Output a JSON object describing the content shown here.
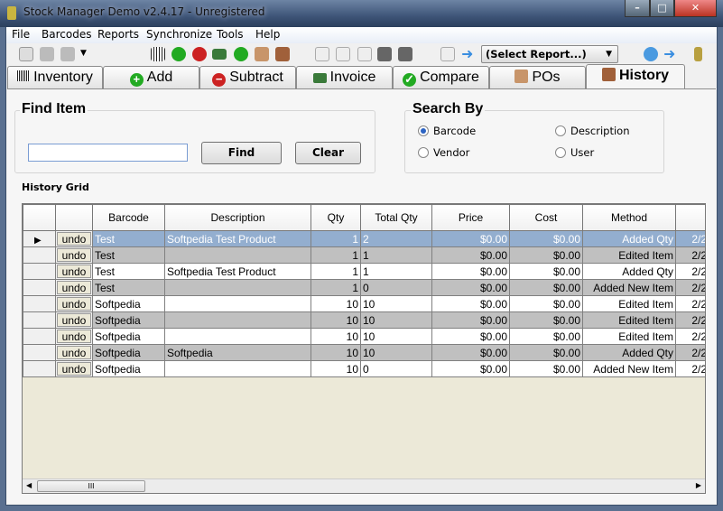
{
  "window": {
    "title": "Stock Manager Demo v2.4.17 - Unregistered",
    "minimize": "–",
    "maximize": "□",
    "close": "✕"
  },
  "menu": [
    "File",
    "Barcodes",
    "Reports",
    "Synchronize",
    "Tools",
    "Help"
  ],
  "toolbar": {
    "report_select": "(Select Report...)"
  },
  "tabs": [
    {
      "label": "Inventory"
    },
    {
      "label": "Add"
    },
    {
      "label": "Subtract"
    },
    {
      "label": "Invoice"
    },
    {
      "label": "Compare"
    },
    {
      "label": "POs"
    },
    {
      "label": "History"
    }
  ],
  "find": {
    "title": "Find Item",
    "value": "",
    "find_label": "Find",
    "clear_label": "Clear"
  },
  "search_by": {
    "title": "Search By",
    "options": [
      "Barcode",
      "Description",
      "Vendor",
      "User"
    ],
    "selected": "Barcode"
  },
  "grid": {
    "title": "History Grid",
    "columns": [
      "",
      "",
      "Barcode",
      "Description",
      "Qty",
      "Total Qty",
      "Price",
      "Cost",
      "Method",
      ""
    ],
    "undo_label": "undo",
    "rows": [
      {
        "barcode": "Test",
        "description": "Softpedia Test Product",
        "qty": "1",
        "total": "2",
        "price": "$0.00",
        "cost": "$0.00",
        "method": "Added Qty",
        "date": "2/2"
      },
      {
        "barcode": "Test",
        "description": "",
        "qty": "1",
        "total": "1",
        "price": "$0.00",
        "cost": "$0.00",
        "method": "Edited Item",
        "date": "2/2"
      },
      {
        "barcode": "Test",
        "description": "Softpedia Test Product",
        "qty": "1",
        "total": "1",
        "price": "$0.00",
        "cost": "$0.00",
        "method": "Added Qty",
        "date": "2/2"
      },
      {
        "barcode": "Test",
        "description": "",
        "qty": "1",
        "total": "0",
        "price": "$0.00",
        "cost": "$0.00",
        "method": "Added New Item",
        "date": "2/2"
      },
      {
        "barcode": "Softpedia",
        "description": "",
        "qty": "10",
        "total": "10",
        "price": "$0.00",
        "cost": "$0.00",
        "method": "Edited Item",
        "date": "2/2"
      },
      {
        "barcode": "Softpedia",
        "description": "",
        "qty": "10",
        "total": "10",
        "price": "$0.00",
        "cost": "$0.00",
        "method": "Edited Item",
        "date": "2/2"
      },
      {
        "barcode": "Softpedia",
        "description": "",
        "qty": "10",
        "total": "10",
        "price": "$0.00",
        "cost": "$0.00",
        "method": "Edited Item",
        "date": "2/2"
      },
      {
        "barcode": "Softpedia",
        "description": "Softpedia",
        "qty": "10",
        "total": "10",
        "price": "$0.00",
        "cost": "$0.00",
        "method": "Added Qty",
        "date": "2/2"
      },
      {
        "barcode": "Softpedia",
        "description": "",
        "qty": "10",
        "total": "0",
        "price": "$0.00",
        "cost": "$0.00",
        "method": "Added New Item",
        "date": "2/2"
      }
    ]
  },
  "scrollbar": {
    "thumb_grip": "III"
  }
}
